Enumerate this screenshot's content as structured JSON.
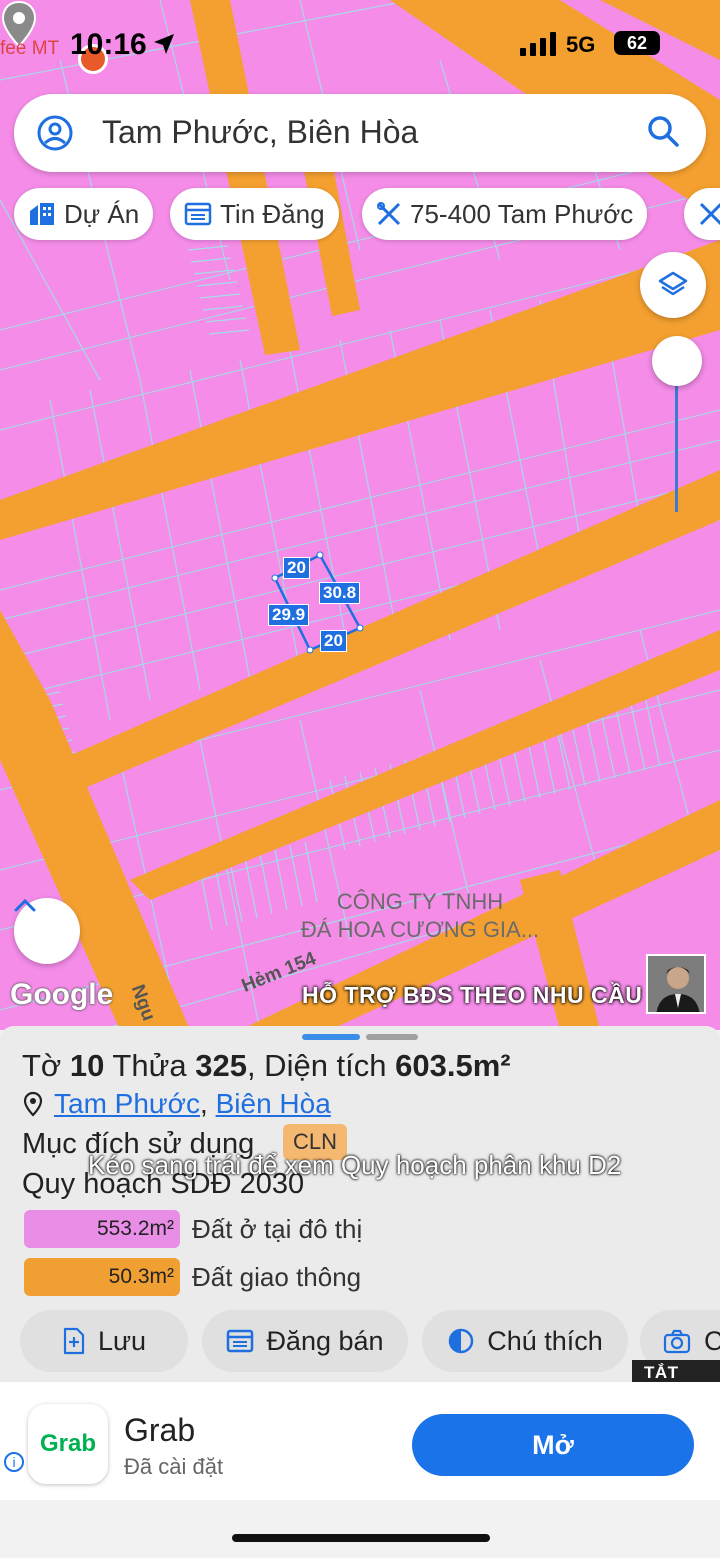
{
  "status_bar": {
    "carrier_fragment": "fee MT",
    "time": "10:16",
    "network": "5G",
    "battery": "62"
  },
  "search": {
    "value": "Tam Phước, Biên Hòa"
  },
  "chips": [
    {
      "label": "Dự Án",
      "icon": "building-icon"
    },
    {
      "label": "Tin Đăng",
      "icon": "list-icon"
    },
    {
      "label": "75-400 Tam Phước",
      "icon": "ruler-icon"
    }
  ],
  "map": {
    "colors": {
      "residential": "#f48ce8",
      "road": "#f4a030",
      "parcel_line": "#9fd8e8",
      "highlight": "#1f6fe0"
    },
    "parcel_labels": {
      "top": "20",
      "right": "30.8",
      "left": "29.9",
      "bottom": "20"
    },
    "poi": {
      "line1": "CÔNG TY TNHH",
      "line2": "ĐÁ HOA CƯƠNG GIA..."
    },
    "street_hem": "Hẻm 154",
    "street_ngu": "Ngu",
    "google_logo": "Google",
    "overlay_caption": "HỖ TRỢ BĐS  THEO NHU CẦU"
  },
  "sheet": {
    "title_prefix": "Tờ ",
    "to_number": "10",
    "title_mid": " Thửa ",
    "thua_number": "325",
    "title_area_prefix": ", Diện tích ",
    "area": "603.5m²",
    "location_ward": "Tam Phước",
    "location_city": "Biên Hòa",
    "purpose_label": "Mục đích sử dụng",
    "purpose_code": "CLN",
    "overlay_text": "Kéo sang trái để xem Quy hoạch phân khu D2",
    "plan_label": "Quy hoạch SDĐ 2030",
    "plan_items": [
      {
        "value": "553.2m²",
        "label": "Đất ở tại đô thị",
        "color": "#e88ee6"
      },
      {
        "value": "50.3m²",
        "label": "Đất giao thông",
        "color": "#f0a033"
      }
    ],
    "actions": [
      {
        "label": "Lưu",
        "icon": "bookmark-add-icon"
      },
      {
        "label": "Đăng bán",
        "icon": "listing-icon"
      },
      {
        "label": "Chú thích",
        "icon": "legend-icon"
      },
      {
        "label": "C",
        "icon": "camera-icon"
      }
    ],
    "tat_qc": "TẮT QC"
  },
  "ad": {
    "app_icon_text": "Grab",
    "name": "Grab",
    "subtitle": "Đã cài đặt",
    "cta": "Mở",
    "info": "i"
  }
}
